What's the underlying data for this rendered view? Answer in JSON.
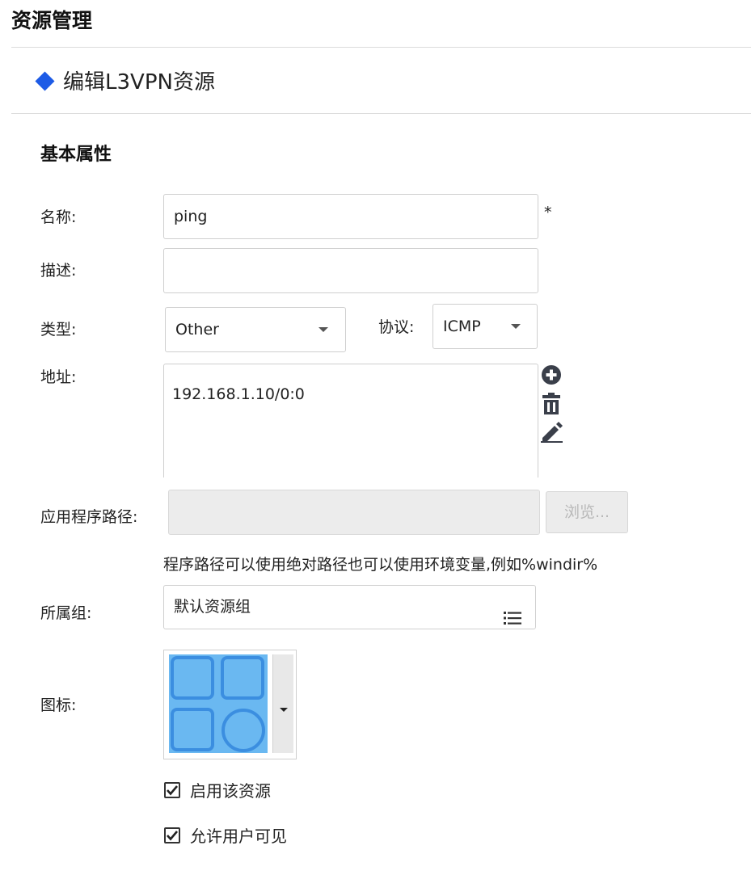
{
  "page": {
    "title": "资源管理",
    "subtitle": "编辑L3VPN资源"
  },
  "section": {
    "title": "基本属性"
  },
  "form": {
    "name": {
      "label": "名称:",
      "value": "ping",
      "required_mark": "*"
    },
    "description": {
      "label": "描述:",
      "value": ""
    },
    "type": {
      "label": "类型:",
      "value": "Other"
    },
    "protocol": {
      "label": "协议:",
      "value": "ICMP"
    },
    "address": {
      "label": "地址:",
      "value": "192.168.1.10/0:0",
      "actions": [
        "add-circle-icon",
        "trash-icon",
        "pencil-icon"
      ]
    },
    "app_path": {
      "label": "应用程序路径:",
      "value": "",
      "browse_label": "浏览...",
      "hint": "程序路径可以使用绝对路径也可以使用环境变量,例如%windir%"
    },
    "group": {
      "label": "所属组:",
      "value": "默认资源组",
      "icon": "list-icon"
    },
    "icon": {
      "label": "图标:",
      "selected_icon": "grid-shapes-icon"
    },
    "enable": {
      "label": "启用该资源",
      "checked": true
    },
    "user_visible": {
      "label": "允许用户可见",
      "checked": true
    }
  },
  "colors": {
    "accent": "#1d5be6",
    "icon_fill": "#6ab8f1",
    "icon_stroke": "#3b8ee0"
  }
}
